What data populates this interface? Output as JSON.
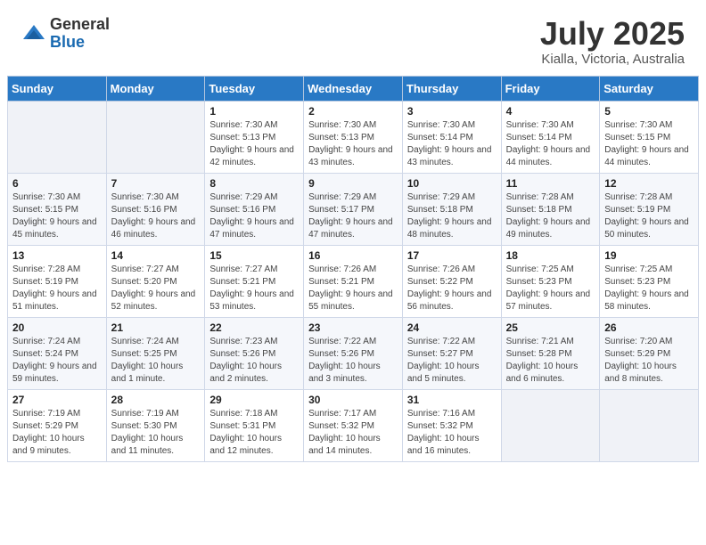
{
  "header": {
    "logo_general": "General",
    "logo_blue": "Blue",
    "month": "July 2025",
    "location": "Kialla, Victoria, Australia"
  },
  "weekdays": [
    "Sunday",
    "Monday",
    "Tuesday",
    "Wednesday",
    "Thursday",
    "Friday",
    "Saturday"
  ],
  "weeks": [
    [
      {
        "day": "",
        "sunrise": "",
        "sunset": "",
        "daylight": ""
      },
      {
        "day": "",
        "sunrise": "",
        "sunset": "",
        "daylight": ""
      },
      {
        "day": "1",
        "sunrise": "Sunrise: 7:30 AM",
        "sunset": "Sunset: 5:13 PM",
        "daylight": "Daylight: 9 hours and 42 minutes."
      },
      {
        "day": "2",
        "sunrise": "Sunrise: 7:30 AM",
        "sunset": "Sunset: 5:13 PM",
        "daylight": "Daylight: 9 hours and 43 minutes."
      },
      {
        "day": "3",
        "sunrise": "Sunrise: 7:30 AM",
        "sunset": "Sunset: 5:14 PM",
        "daylight": "Daylight: 9 hours and 43 minutes."
      },
      {
        "day": "4",
        "sunrise": "Sunrise: 7:30 AM",
        "sunset": "Sunset: 5:14 PM",
        "daylight": "Daylight: 9 hours and 44 minutes."
      },
      {
        "day": "5",
        "sunrise": "Sunrise: 7:30 AM",
        "sunset": "Sunset: 5:15 PM",
        "daylight": "Daylight: 9 hours and 44 minutes."
      }
    ],
    [
      {
        "day": "6",
        "sunrise": "Sunrise: 7:30 AM",
        "sunset": "Sunset: 5:15 PM",
        "daylight": "Daylight: 9 hours and 45 minutes."
      },
      {
        "day": "7",
        "sunrise": "Sunrise: 7:30 AM",
        "sunset": "Sunset: 5:16 PM",
        "daylight": "Daylight: 9 hours and 46 minutes."
      },
      {
        "day": "8",
        "sunrise": "Sunrise: 7:29 AM",
        "sunset": "Sunset: 5:16 PM",
        "daylight": "Daylight: 9 hours and 47 minutes."
      },
      {
        "day": "9",
        "sunrise": "Sunrise: 7:29 AM",
        "sunset": "Sunset: 5:17 PM",
        "daylight": "Daylight: 9 hours and 47 minutes."
      },
      {
        "day": "10",
        "sunrise": "Sunrise: 7:29 AM",
        "sunset": "Sunset: 5:18 PM",
        "daylight": "Daylight: 9 hours and 48 minutes."
      },
      {
        "day": "11",
        "sunrise": "Sunrise: 7:28 AM",
        "sunset": "Sunset: 5:18 PM",
        "daylight": "Daylight: 9 hours and 49 minutes."
      },
      {
        "day": "12",
        "sunrise": "Sunrise: 7:28 AM",
        "sunset": "Sunset: 5:19 PM",
        "daylight": "Daylight: 9 hours and 50 minutes."
      }
    ],
    [
      {
        "day": "13",
        "sunrise": "Sunrise: 7:28 AM",
        "sunset": "Sunset: 5:19 PM",
        "daylight": "Daylight: 9 hours and 51 minutes."
      },
      {
        "day": "14",
        "sunrise": "Sunrise: 7:27 AM",
        "sunset": "Sunset: 5:20 PM",
        "daylight": "Daylight: 9 hours and 52 minutes."
      },
      {
        "day": "15",
        "sunrise": "Sunrise: 7:27 AM",
        "sunset": "Sunset: 5:21 PM",
        "daylight": "Daylight: 9 hours and 53 minutes."
      },
      {
        "day": "16",
        "sunrise": "Sunrise: 7:26 AM",
        "sunset": "Sunset: 5:21 PM",
        "daylight": "Daylight: 9 hours and 55 minutes."
      },
      {
        "day": "17",
        "sunrise": "Sunrise: 7:26 AM",
        "sunset": "Sunset: 5:22 PM",
        "daylight": "Daylight: 9 hours and 56 minutes."
      },
      {
        "day": "18",
        "sunrise": "Sunrise: 7:25 AM",
        "sunset": "Sunset: 5:23 PM",
        "daylight": "Daylight: 9 hours and 57 minutes."
      },
      {
        "day": "19",
        "sunrise": "Sunrise: 7:25 AM",
        "sunset": "Sunset: 5:23 PM",
        "daylight": "Daylight: 9 hours and 58 minutes."
      }
    ],
    [
      {
        "day": "20",
        "sunrise": "Sunrise: 7:24 AM",
        "sunset": "Sunset: 5:24 PM",
        "daylight": "Daylight: 9 hours and 59 minutes."
      },
      {
        "day": "21",
        "sunrise": "Sunrise: 7:24 AM",
        "sunset": "Sunset: 5:25 PM",
        "daylight": "Daylight: 10 hours and 1 minute."
      },
      {
        "day": "22",
        "sunrise": "Sunrise: 7:23 AM",
        "sunset": "Sunset: 5:26 PM",
        "daylight": "Daylight: 10 hours and 2 minutes."
      },
      {
        "day": "23",
        "sunrise": "Sunrise: 7:22 AM",
        "sunset": "Sunset: 5:26 PM",
        "daylight": "Daylight: 10 hours and 3 minutes."
      },
      {
        "day": "24",
        "sunrise": "Sunrise: 7:22 AM",
        "sunset": "Sunset: 5:27 PM",
        "daylight": "Daylight: 10 hours and 5 minutes."
      },
      {
        "day": "25",
        "sunrise": "Sunrise: 7:21 AM",
        "sunset": "Sunset: 5:28 PM",
        "daylight": "Daylight: 10 hours and 6 minutes."
      },
      {
        "day": "26",
        "sunrise": "Sunrise: 7:20 AM",
        "sunset": "Sunset: 5:29 PM",
        "daylight": "Daylight: 10 hours and 8 minutes."
      }
    ],
    [
      {
        "day": "27",
        "sunrise": "Sunrise: 7:19 AM",
        "sunset": "Sunset: 5:29 PM",
        "daylight": "Daylight: 10 hours and 9 minutes."
      },
      {
        "day": "28",
        "sunrise": "Sunrise: 7:19 AM",
        "sunset": "Sunset: 5:30 PM",
        "daylight": "Daylight: 10 hours and 11 minutes."
      },
      {
        "day": "29",
        "sunrise": "Sunrise: 7:18 AM",
        "sunset": "Sunset: 5:31 PM",
        "daylight": "Daylight: 10 hours and 12 minutes."
      },
      {
        "day": "30",
        "sunrise": "Sunrise: 7:17 AM",
        "sunset": "Sunset: 5:32 PM",
        "daylight": "Daylight: 10 hours and 14 minutes."
      },
      {
        "day": "31",
        "sunrise": "Sunrise: 7:16 AM",
        "sunset": "Sunset: 5:32 PM",
        "daylight": "Daylight: 10 hours and 16 minutes."
      },
      {
        "day": "",
        "sunrise": "",
        "sunset": "",
        "daylight": ""
      },
      {
        "day": "",
        "sunrise": "",
        "sunset": "",
        "daylight": ""
      }
    ]
  ]
}
